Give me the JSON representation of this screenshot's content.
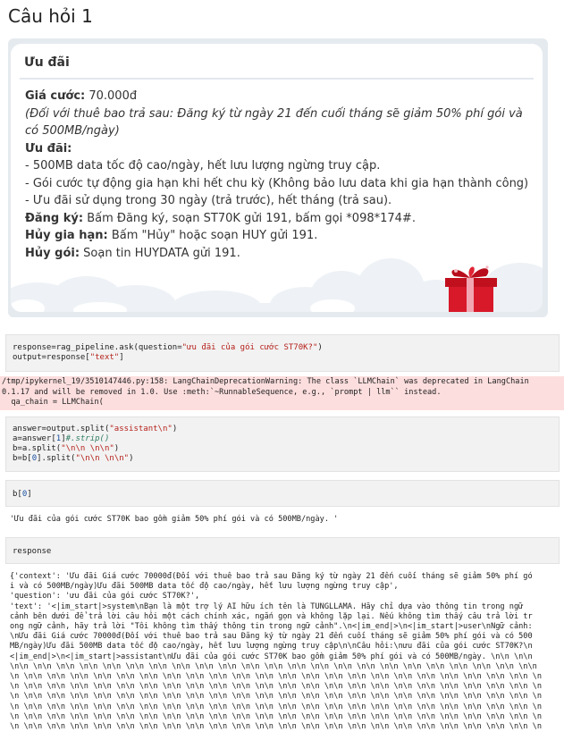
{
  "page_title": "Câu hỏi 1",
  "promo_card": {
    "title": "Ưu đãi",
    "price_label": "Giá cước:",
    "price_value": " 70.000đ",
    "note": "(Đối với thuê bao trả sau: Đăng ký từ ngày 21 đến cuối tháng sẽ giảm 50% phí gói và có 500MB/ngày)",
    "benefits_label": "Ưu đãi:",
    "benefits": [
      "- 500MB data tốc độ cao/ngày, hết lưu lượng ngừng truy cập.",
      "- Gói cước tự động gia hạn khi hết chu kỳ (Không bảo lưu data khi gia hạn thành công)",
      "- Ưu đãi sử dụng trong 30 ngày (trả trước), hết tháng (trả sau)."
    ],
    "register_label": "Đăng ký:",
    "register_text": " Bấm Đăng ký, soạn ST70K gửi 191, bấm gọi *098*174#.",
    "cancel_renew_label": "Hủy gia hạn:",
    "cancel_renew_text": " Bấm \"Hủy\" hoặc soạn HUY gửi 191.",
    "cancel_label": "Hủy gói:",
    "cancel_text": " Soạn tin HUYDATA gửi 191."
  },
  "cells": {
    "c1": {
      "l1a": "response=rag_pipeline.ask(question=",
      "l1s": "\"ưu đãi của gói cước ST70K?\"",
      "l1b": ")",
      "l2a": "output=response[",
      "l2s": "\"text\"",
      "l2b": "]"
    },
    "warning": "/tmp/ipykernel_19/3510147446.py:158: LangChainDeprecationWarning: The class `LLMChain` was deprecated in LangChain\n0.1.17 and will be removed in 1.0. Use :meth:`~RunnableSequence, e.g., `prompt | llm`` instead.\n  qa_chain = LLMChain(",
    "c2": {
      "l1a": "answer=output.split(",
      "l1s": "\"assistant\\n\"",
      "l1b": ")",
      "l2a": "a=answer[",
      "l2n": "1",
      "l2b": "]",
      "l2c": "#.strip()",
      "l3a": "b=a.split(",
      "l3s": "\"\\n\\n \\n\\n\"",
      "l3b": ")",
      "l4a": "b=b[",
      "l4n": "0",
      "l4b": "].split(",
      "l4s": "\"\\n\\n \\n\\n\"",
      "l4c": ")"
    },
    "c3": {
      "a": "b[",
      "n": "0",
      "b": "]"
    },
    "c3_output": "'Ưu đãi của gói cước ST70K bao gồm giảm 50% phí gói và có 500MB/ngày. '",
    "c4": "response",
    "c4_output": [
      "{'context': 'Ưu đãi Giá cước 70000đ(Đối với thuê bao trả sau Đăng ký từ ngày 21 đến cuối tháng sẽ giảm 50% phí gó",
      "i và có 500MB/ngày)Ưu đãi 500MB data tốc độ cao/ngày, hết lưu lượng ngừng truy cập',",
      " 'question': 'ưu đãi của gói cước ST70K?',",
      " 'text': '<|im_start|>system\\nBạn là một trợ lý AI hữu ích tên là TUNGLLAMA. Hãy chỉ dựa vào thông tin trong ngữ",
      "cảnh bên dưới để trả lời câu hỏi một cách chính xác, ngắn gọn và không lặp lại. Nếu không tìm thấy câu trả lời tr",
      "ong ngữ cảnh, hãy trả lời \"Tôi không tìm thấy thông tin trong ngữ cảnh\".\\n<|im_end|>\\n<|im_start|>user\\nNgữ cảnh:",
      "\\nƯu đãi Giá cước 70000đ(Đối với thuê bao trả sau Đăng ký từ ngày 21 đến cuối tháng sẽ giảm 50% phí gói và có 500",
      "MB/ngày)Ưu đãi 500MB data tốc độ cao/ngày, hết lưu lượng ngừng truy cập\\n\\nCâu hỏi:\\nưu đãi của gói cước ST70K?\\n",
      "<|im_end|>\\n<|im_start|>assistant\\nƯu đãi của gói cước ST70K bao gồm giảm 50% phí gói và có 500MB/ngày. \\n\\n \\n\\n",
      "\\n\\n \\n\\n \\n\\n \\n\\n \\n\\n \\n\\n \\n\\n \\n\\n \\n\\n \\n\\n \\n\\n \\n\\n \\n\\n \\n\\n \\n\\n \\n\\n \\n\\n \\n\\n \\n\\n \\n\\n \\n\\n \\n\\n \\n\\n",
      "\\n \\n\\n \\n\\n \\n\\n \\n\\n \\n\\n \\n\\n \\n\\n \\n\\n \\n\\n \\n\\n \\n\\n \\n\\n \\n\\n \\n\\n \\n\\n \\n\\n \\n\\n \\n\\n \\n\\n \\n\\n \\n\\n \\n\\n \\n",
      "\\n \\n\\n \\n\\n \\n\\n \\n\\n \\n\\n \\n\\n \\n\\n \\n\\n \\n\\n \\n\\n \\n\\n \\n\\n \\n\\n \\n\\n \\n\\n \\n\\n \\n\\n \\n\\n \\n\\n \\n\\n \\n\\n \\n\\n \\n",
      "\\n \\n\\n \\n\\n \\n\\n \\n\\n \\n\\n \\n\\n \\n\\n \\n\\n \\n\\n \\n\\n \\n\\n \\n\\n \\n\\n \\n\\n \\n\\n \\n\\n \\n\\n \\n\\n \\n\\n \\n\\n \\n\\n \\n\\n \\n",
      "\\n \\n\\n \\n\\n \\n\\n \\n\\n \\n\\n \\n\\n \\n\\n \\n\\n \\n\\n \\n\\n \\n\\n \\n\\n \\n\\n \\n\\n \\n\\n \\n\\n \\n\\n \\n\\n \\n\\n \\n\\n \\n\\n \\n\\n \\n",
      "\\n \\n\\n \\n\\n \\n\\n \\n\\n \\n\\n \\n\\n \\n\\n \\n\\n \\n\\n \\n\\n \\n\\n \\n\\n \\n\\n \\n\\n \\n\\n \\n\\n \\n\\n \\n\\n \\n\\n \\n\\n \\n\\n \\n\\n \\n",
      "\\n \\n\\n \\n\\n \\n\\n \\n\\n \\n\\n \\n\\n \\n\\n \\n\\n \\n\\n \\n\\n \\n\\n \\n\\n \\n\\n \\n\\n \\n\\n \\n\\n \\n\\n \\n\\n \\n\\n \\n\\n \\n\\n \\n\\n \\n",
      "n \\n\\n \\n\\n \\n\\n \\n\\n \\n\\n \\n\\n \\n\\n \\n\\n'}"
    ]
  }
}
